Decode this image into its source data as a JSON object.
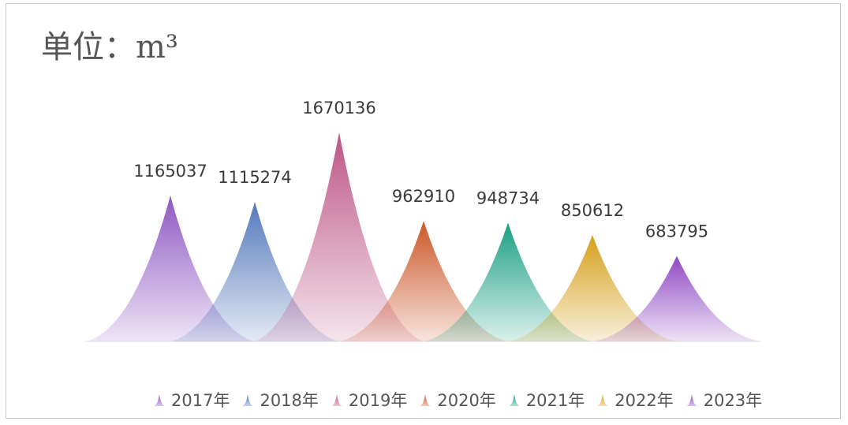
{
  "chart_data": {
    "type": "bar",
    "title": "",
    "unit_label": "单位：m³",
    "categories": [
      "2017年",
      "2018年",
      "2019年",
      "2020年",
      "2021年",
      "2022年",
      "2023年"
    ],
    "values": [
      1165037,
      1115274,
      1670136,
      962910,
      948734,
      850612,
      683795
    ],
    "data_labels": [
      "1165037",
      "1115274",
      "1670136",
      "962910",
      "948734",
      "850612",
      "683795"
    ],
    "colors": [
      "#8a4fc0",
      "#4a72b8",
      "#b94d7f",
      "#c94e1d",
      "#0f9a7c",
      "#d49a0f",
      "#8a3fc0"
    ],
    "ylim": [
      0,
      1670136
    ],
    "legend_position": "bottom",
    "grid": false
  }
}
